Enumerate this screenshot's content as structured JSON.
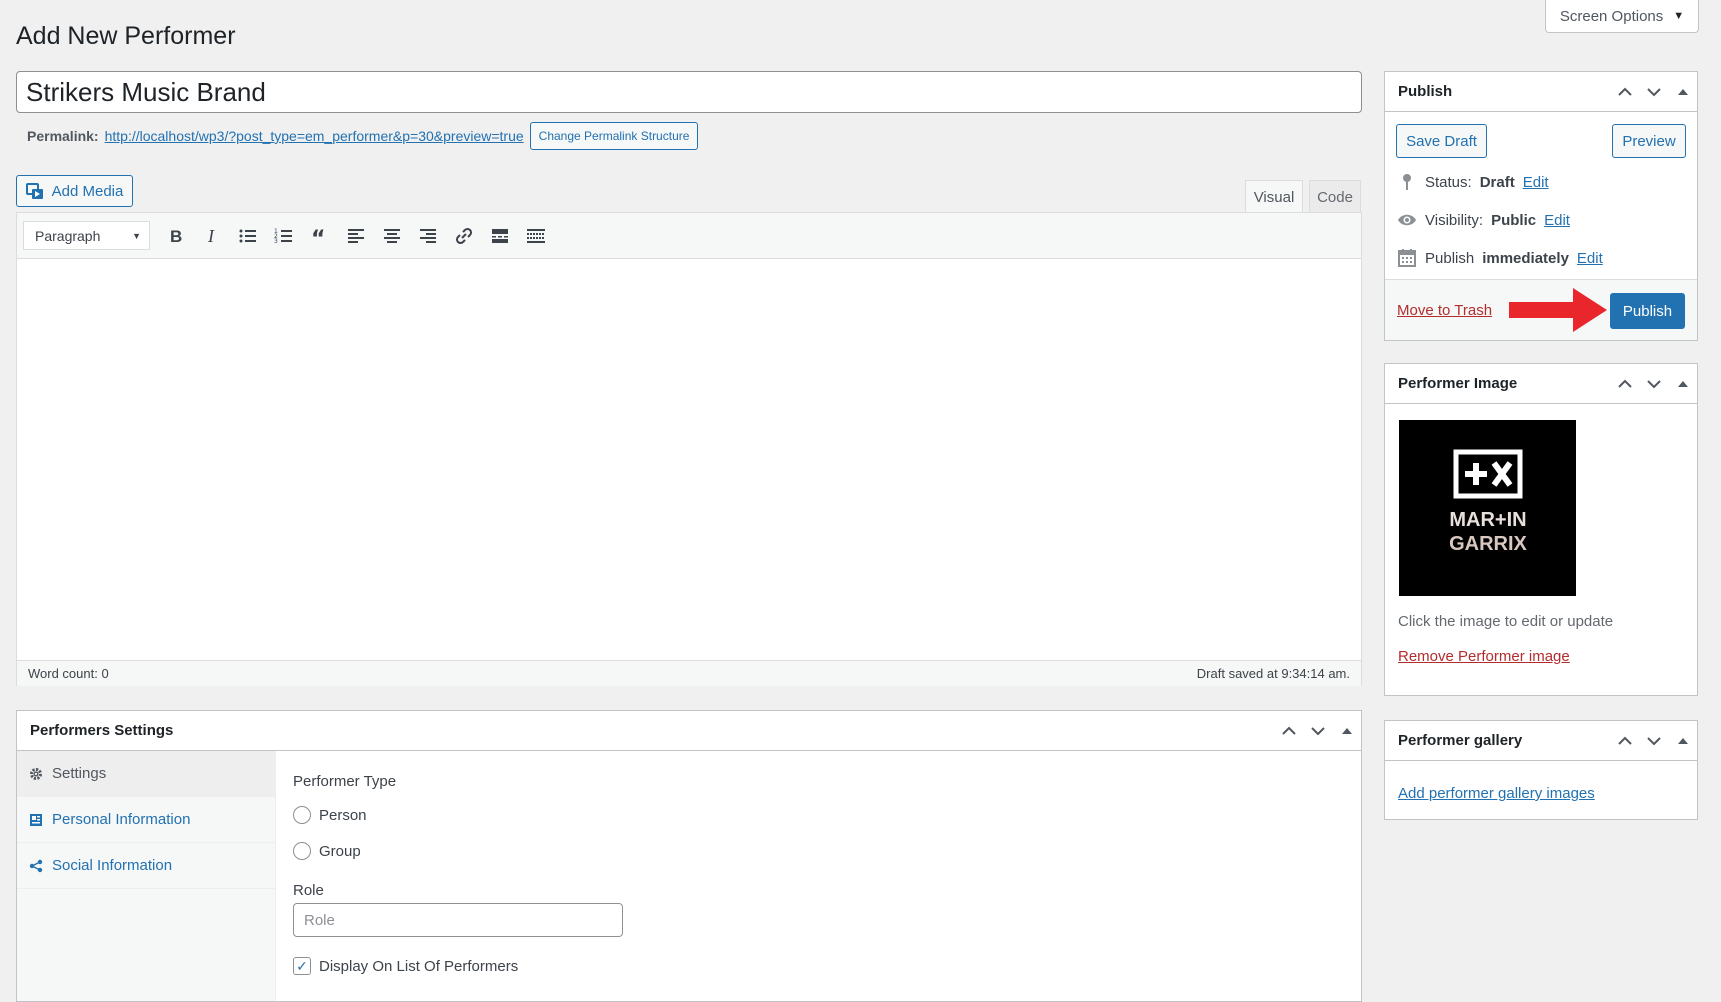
{
  "screen_options": {
    "label": "Screen Options"
  },
  "page": {
    "title": "Add New Performer"
  },
  "post_title": {
    "value": "Strikers Music Brand"
  },
  "permalink": {
    "label": "Permalink:",
    "url": "http://localhost/wp3/?post_type=em_performer&p=30&preview=true",
    "change_button": "Change Permalink Structure"
  },
  "editor": {
    "add_media": "Add Media",
    "tabs": {
      "visual": "Visual",
      "code": "Code"
    },
    "format_select": "Paragraph",
    "toolbar_icons": [
      "bold-icon",
      "italic-icon",
      "bullet-list-icon",
      "numbered-list-icon",
      "blockquote-icon",
      "align-left-icon",
      "align-center-icon",
      "align-right-icon",
      "link-icon",
      "read-more-icon",
      "toolbar-toggle-icon"
    ],
    "word_count": "Word count: 0",
    "draft_saved": "Draft saved at 9:34:14 am."
  },
  "performers_settings": {
    "title": "Performers Settings",
    "tabs": [
      {
        "label": "Settings",
        "icon": "gear-icon"
      },
      {
        "label": "Personal Information",
        "icon": "id-card-icon"
      },
      {
        "label": "Social Information",
        "icon": "share-icon"
      }
    ],
    "performer_type_label": "Performer Type",
    "options": [
      "Person",
      "Group"
    ],
    "role_label": "Role",
    "role_placeholder": "Role",
    "display_checkbox": "Display On List Of Performers",
    "display_checked": true
  },
  "publish": {
    "title": "Publish",
    "save_draft": "Save Draft",
    "preview": "Preview",
    "status_label": "Status:",
    "status_value": "Draft",
    "visibility_label": "Visibility:",
    "visibility_value": "Public",
    "publish_label": "Publish",
    "publish_value": "immediately",
    "edit": "Edit",
    "trash": "Move to Trash",
    "publish_button": "Publish",
    "arrow_color": "#e8262b"
  },
  "performer_image": {
    "title": "Performer Image",
    "logo_line1": "MAR+IN",
    "logo_line2": "GARRIX",
    "caption": "Click the image to edit or update",
    "remove": "Remove Performer image"
  },
  "performer_gallery": {
    "title": "Performer gallery",
    "add_link": "Add performer gallery images"
  },
  "colors": {
    "accent": "#2271b1",
    "danger": "#b32d2e",
    "background": "#f0f0f1"
  }
}
